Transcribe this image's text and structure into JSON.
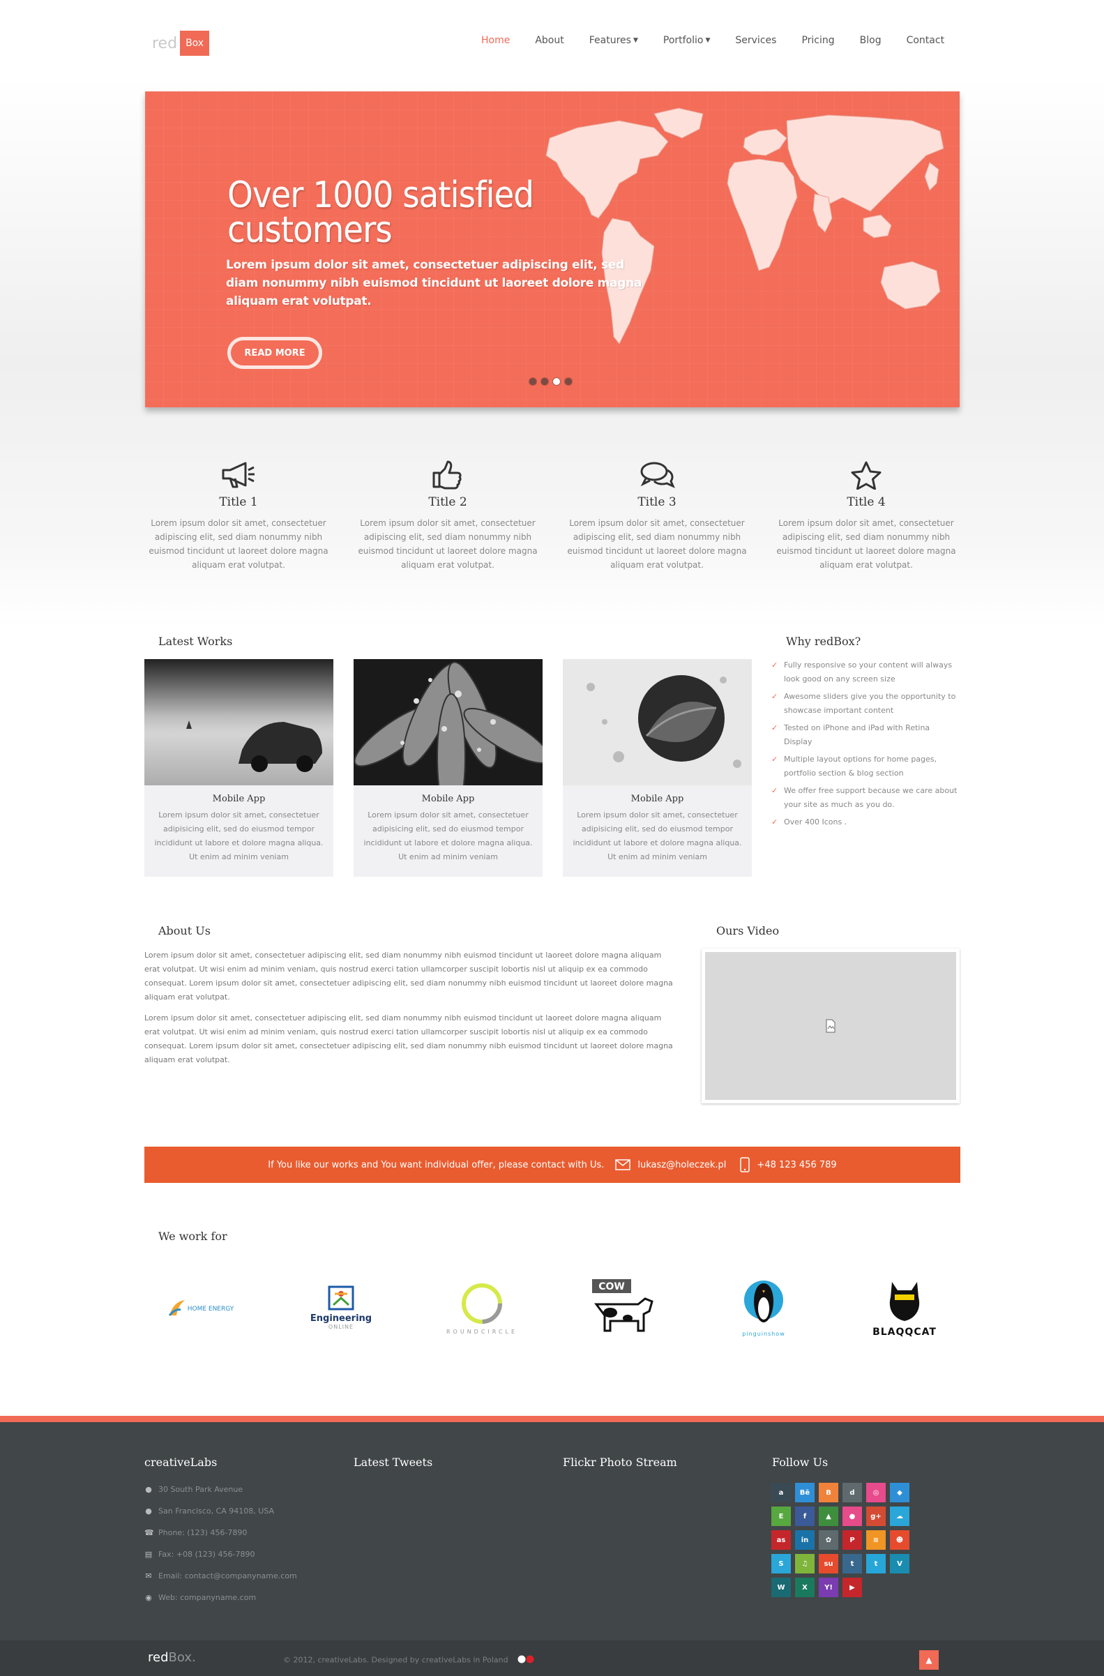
{
  "header": {
    "logo_red": "red",
    "logo_box": "Box",
    "nav": [
      "Home",
      "About",
      "Features",
      "Portfolio",
      "Services",
      "Pricing",
      "Blog",
      "Contact"
    ]
  },
  "slider": {
    "title": "Over 1000 satisfied customers",
    "text": "Lorem ipsum dolor sit amet, consectetuer adipiscing elit, sed diam nonummy nibh euismod tincidunt ut laoreet dolore magna aliquam erat volutpat.",
    "button": "READ MORE",
    "slides": 4,
    "active_slide": 3
  },
  "features": [
    {
      "icon": "megaphone-icon",
      "title": "Title 1",
      "text": "Lorem ipsum dolor sit amet, consectetuer adipiscing elit, sed diam nonummy nibh euismod tincidunt ut laoreet dolore magna aliquam erat volutpat."
    },
    {
      "icon": "thumbs-up-icon",
      "title": "Title 2",
      "text": "Lorem ipsum dolor sit amet, consectetuer adipiscing elit, sed diam nonummy nibh euismod tincidunt ut laoreet dolore magna aliquam erat volutpat."
    },
    {
      "icon": "chat-bubbles-icon",
      "title": "Title 3",
      "text": "Lorem ipsum dolor sit amet, consectetuer adipiscing elit, sed diam nonummy nibh euismod tincidunt ut laoreet dolore magna aliquam erat volutpat."
    },
    {
      "icon": "star-icon",
      "title": "Title 4",
      "text": "Lorem ipsum dolor sit amet, consectetuer adipiscing elit, sed diam nonummy nibh euismod tincidunt ut laoreet dolore magna aliquam erat volutpat."
    }
  ],
  "latest_works": {
    "title": "Latest Works",
    "items": [
      {
        "title": "Mobile App",
        "text": "Lorem ipsum dolor sit amet, consectetuer adipisicing elit, sed do eiusmod tempor incididunt ut labore et dolore magna aliqua. Ut enim ad minim veniam"
      },
      {
        "title": "Mobile App",
        "text": "Lorem ipsum dolor sit amet, consectetuer adipisicing elit, sed do eiusmod tempor incididunt ut labore et dolore magna aliqua. Ut enim ad minim veniam"
      },
      {
        "title": "Mobile App",
        "text": "Lorem ipsum dolor sit amet, consectetuer adipisicing elit, sed do eiusmod tempor incididunt ut labore et dolore magna aliqua. Ut enim ad minim veniam"
      }
    ]
  },
  "why": {
    "title": "Why redBox?",
    "items": [
      "Fully responsive so your content will always look good on any screen size",
      "Awesome sliders give you the opportunity to showcase important content",
      "Tested on iPhone and iPad with Retina Display",
      "Multiple layout options for home pages, portfolio section & blog section",
      "We offer free support because we care about your site as much as you do.",
      "Over 400 Icons ."
    ]
  },
  "about": {
    "title": "About Us",
    "paragraphs": [
      "Lorem ipsum dolor sit amet, consectetuer adipiscing elit, sed diam nonummy nibh euismod tincidunt ut laoreet dolore magna aliquam erat volutpat. Ut wisi enim ad minim veniam, quis nostrud exerci tation ullamcorper suscipit lobortis nisl ut aliquip ex ea commodo consequat. Lorem ipsum dolor sit amet, consectetuer adipiscing elit, sed diam nonummy nibh euismod tincidunt ut laoreet dolore magna aliquam erat volutpat.",
      "Lorem ipsum dolor sit amet, consectetuer adipiscing elit, sed diam nonummy nibh euismod tincidunt ut laoreet dolore magna aliquam erat volutpat. Ut wisi enim ad minim veniam, quis nostrud exerci tation ullamcorper suscipit lobortis nisl ut aliquip ex ea commodo consequat. Lorem ipsum dolor sit amet, consectetuer adipiscing elit, sed diam nonummy nibh euismod tincidunt ut laoreet dolore magna aliquam erat volutpat."
    ]
  },
  "video": {
    "title": "Ours Video"
  },
  "contact_bar": {
    "text": "If You like our works and You want individual offer, please contact with Us.",
    "email": "lukasz@holeczek.pl",
    "phone": "+48 123 456 789"
  },
  "clients": {
    "title": "We work for",
    "items": [
      {
        "name": "HOME ENERGY"
      },
      {
        "name": "Engineering",
        "sub": "ONLINE"
      },
      {
        "name": "ROUNDCIRCLE"
      },
      {
        "name": "COW"
      },
      {
        "name": "pinguinshow"
      },
      {
        "name": "BLAQQCAT"
      }
    ]
  },
  "footer": {
    "col1_title": "creativeLabs",
    "info": [
      {
        "icon": "map-pin-icon",
        "text": "30 South Park Avenue"
      },
      {
        "icon": "map-pin-icon",
        "text": "San Francisco, CA 94108, USA"
      },
      {
        "icon": "phone-icon",
        "text": "Phone: (123) 456-7890"
      },
      {
        "icon": "fax-icon",
        "text": "Fax: +08 (123) 456-7890"
      },
      {
        "icon": "envelope-icon",
        "text": "Email: contact@companyname.com"
      },
      {
        "icon": "globe-icon",
        "text": "Web: companyname.com"
      }
    ],
    "col2_title": "Latest Tweets",
    "col3_title": "Flickr Photo Stream",
    "col4_title": "Follow Us",
    "social": [
      {
        "name": "amazon-icon",
        "glyph": "a",
        "color": "#3a4a55"
      },
      {
        "name": "behance-icon",
        "glyph": "Bē",
        "color": "#2f8fd6"
      },
      {
        "name": "blogger-icon",
        "glyph": "B",
        "color": "#f0823a"
      },
      {
        "name": "delicious-icon",
        "glyph": "d",
        "color": "#5e6a6e"
      },
      {
        "name": "dribbble-icon",
        "glyph": "◎",
        "color": "#e74b8b"
      },
      {
        "name": "dropbox-icon",
        "glyph": "◆",
        "color": "#2f8fd6"
      },
      {
        "name": "evernote-icon",
        "glyph": "E",
        "color": "#57a83f"
      },
      {
        "name": "facebook-icon",
        "glyph": "f",
        "color": "#3a5a98"
      },
      {
        "name": "forrst-icon",
        "glyph": "▲",
        "color": "#3e8e3e"
      },
      {
        "name": "flickr-icon",
        "glyph": "●",
        "color": "#e64b8a"
      },
      {
        "name": "google-plus-icon",
        "glyph": "g+",
        "color": "#d44b34"
      },
      {
        "name": "icloud-icon",
        "glyph": "☁",
        "color": "#2aa6d9"
      },
      {
        "name": "lastfm-icon",
        "glyph": "as",
        "color": "#c5262b"
      },
      {
        "name": "linkedin-icon",
        "glyph": "in",
        "color": "#1a73a8"
      },
      {
        "name": "myspace-icon",
        "glyph": "✿",
        "color": "#5e6a6e"
      },
      {
        "name": "pinterest-icon",
        "glyph": "P",
        "color": "#c5262b"
      },
      {
        "name": "rss-icon",
        "glyph": "≋",
        "color": "#f09424"
      },
      {
        "name": "reddit-icon",
        "glyph": "☻",
        "color": "#e64b2e"
      },
      {
        "name": "skype-icon",
        "glyph": "S",
        "color": "#2aa6d9"
      },
      {
        "name": "spotify-icon",
        "glyph": "♫",
        "color": "#7fb53b"
      },
      {
        "name": "stumbleupon-icon",
        "glyph": "su",
        "color": "#e64b2e"
      },
      {
        "name": "tumblr-icon",
        "glyph": "t",
        "color": "#39688e"
      },
      {
        "name": "twitter-icon",
        "glyph": "t",
        "color": "#27a6d9"
      },
      {
        "name": "vimeo-icon",
        "glyph": "V",
        "color": "#1a8cb0"
      },
      {
        "name": "wordpress-icon",
        "glyph": "W",
        "color": "#1a6a74"
      },
      {
        "name": "xing-icon",
        "glyph": "X",
        "color": "#1a7a5e"
      },
      {
        "name": "yahoo-icon",
        "glyph": "Y!",
        "color": "#7a3cb0"
      },
      {
        "name": "youtube-icon",
        "glyph": "▶",
        "color": "#c5262b"
      }
    ]
  },
  "bottom": {
    "logo_main": "red",
    "logo_sub": "Box.",
    "copyright": "© 2012, creativeLabs. Designed by creativeLabs in Poland"
  },
  "colors": {
    "accent": "#f06a55",
    "contact_bar": "#e95c30",
    "footer": "#414648"
  }
}
